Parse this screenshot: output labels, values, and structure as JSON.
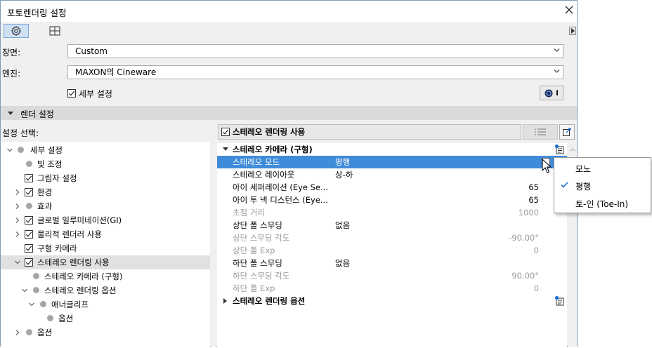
{
  "window": {
    "title": "포토렌더링 설정"
  },
  "toolbar": {
    "tools": [
      {
        "name": "settings",
        "active": true
      },
      {
        "name": "layout",
        "active": false
      }
    ]
  },
  "form": {
    "scene_label": "장면:",
    "scene_value": "Custom",
    "engine_label": "엔진:",
    "engine_value": "MAXON의 Cineware",
    "detail_checkbox_label": "세부 설정",
    "detail_checked": true,
    "info_button_label": "i"
  },
  "render_section": {
    "title": "렌더 설정",
    "select_label": "설정 선택:"
  },
  "tree": {
    "items": [
      {
        "label": "세부 설정",
        "depth": 0,
        "expander": "down",
        "marker": "dot"
      },
      {
        "label": "빛 조정",
        "depth": 1,
        "expander": "none",
        "marker": "dot"
      },
      {
        "label": "그림자 설정",
        "depth": 1,
        "expander": "none",
        "marker": "check"
      },
      {
        "label": "환경",
        "depth": 1,
        "expander": "right",
        "marker": "check"
      },
      {
        "label": "효과",
        "depth": 1,
        "expander": "right",
        "marker": "dot"
      },
      {
        "label": "글로벌 일루미네이션(GI)",
        "depth": 1,
        "expander": "right",
        "marker": "check"
      },
      {
        "label": "물리적 렌더러 사용",
        "depth": 1,
        "expander": "right",
        "marker": "check"
      },
      {
        "label": "구형 카메라",
        "depth": 1,
        "expander": "none",
        "marker": "check"
      },
      {
        "label": "스테레오 렌더링 사용",
        "depth": 1,
        "expander": "down",
        "marker": "check",
        "selected": true
      },
      {
        "label": "스테레오 카메라 (구형)",
        "depth": 2,
        "expander": "none",
        "marker": "dot"
      },
      {
        "label": "스테레오 렌더링 옵션",
        "depth": 2,
        "expander": "down",
        "marker": "dot"
      },
      {
        "label": "애너글리프",
        "depth": 3,
        "expander": "down",
        "marker": "dot"
      },
      {
        "label": "옵션",
        "depth": 4,
        "expander": "none",
        "marker": "dot"
      },
      {
        "label": "옵션",
        "depth": 1,
        "expander": "right",
        "marker": "dot"
      }
    ]
  },
  "right_panel": {
    "enable_label": "스테레오 렌더링 사용",
    "enable_checked": true,
    "group1_title": "스테레오 카메라 (구형)",
    "rows": [
      {
        "label": "스테레오 모드",
        "value": "평행",
        "num": "",
        "state": "selected"
      },
      {
        "label": "스테레오 레이아웃",
        "value": "상-하",
        "num": "",
        "state": "normal"
      },
      {
        "label": "아이 세퍼레이션 (Eye Se...",
        "value": "",
        "num": "65",
        "state": "normal"
      },
      {
        "label": "아이 투 넥 디스턴스 (Eye...",
        "value": "",
        "num": "65",
        "state": "normal"
      },
      {
        "label": "초점 거리",
        "value": "",
        "num": "1000",
        "state": "disabled"
      },
      {
        "label": "상단 폴 스무딩",
        "value": "없음",
        "num": "",
        "state": "normal"
      },
      {
        "label": "상단 스무딩 각도",
        "value": "",
        "num": "-90.00°",
        "state": "disabled"
      },
      {
        "label": "상단 폴 Exp",
        "value": "",
        "num": "0",
        "state": "disabled"
      },
      {
        "label": "하단 폴 스무딩",
        "value": "없음",
        "num": "",
        "state": "normal"
      },
      {
        "label": "하단 스무딩 각도",
        "value": "",
        "num": "90.00°",
        "state": "disabled"
      },
      {
        "label": "하단 폴 Exp",
        "value": "",
        "num": "0",
        "state": "disabled"
      }
    ],
    "group2_title": "스테레오 렌더링 옵션"
  },
  "popup": {
    "items": [
      {
        "label": "모노",
        "checked": false
      },
      {
        "label": "평행",
        "checked": true
      },
      {
        "label": "토-인 (Toe-In)",
        "checked": false
      }
    ]
  },
  "colors": {
    "selection": "#3f8bd9",
    "tree_selection": "#e1e1e1",
    "section_bg": "#dadada"
  }
}
